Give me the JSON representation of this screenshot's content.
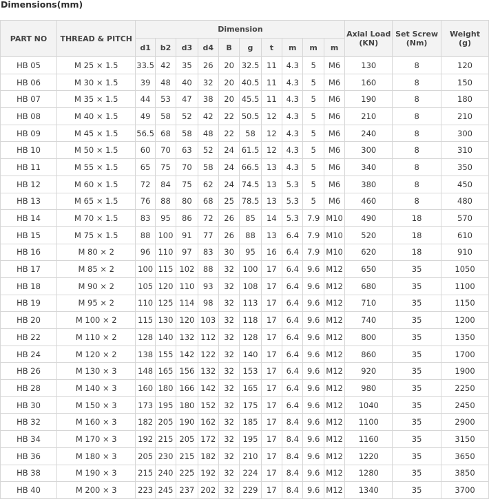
{
  "title": "Dimensions(mm)",
  "header": {
    "part_no": "PART NO",
    "thread_pitch": "THREAD & PITCH",
    "dimension": "Dimension",
    "axial_load": "Axial Load",
    "axial_load_unit": "(KN)",
    "set_screw": "Set Screw",
    "set_screw_unit": "(Nm)",
    "weight": "Weight",
    "weight_unit": "(g)",
    "sub": [
      "d1",
      "b2",
      "d3",
      "d4",
      "B",
      "g",
      "t",
      "m",
      "m",
      "m"
    ]
  },
  "rows": [
    [
      "HB 05",
      "M 25 × 1.5",
      "33.5",
      "42",
      "35",
      "26",
      "20",
      "32.5",
      "11",
      "4.3",
      "5",
      "M6",
      "130",
      "8",
      "120"
    ],
    [
      "HB 06",
      "M 30 × 1.5",
      "39",
      "48",
      "40",
      "32",
      "20",
      "40.5",
      "11",
      "4.3",
      "5",
      "M6",
      "160",
      "8",
      "150"
    ],
    [
      "HB 07",
      "M 35 × 1.5",
      "44",
      "53",
      "47",
      "38",
      "20",
      "45.5",
      "11",
      "4.3",
      "5",
      "M6",
      "190",
      "8",
      "180"
    ],
    [
      "HB 08",
      "M 40 × 1.5",
      "49",
      "58",
      "52",
      "42",
      "22",
      "50.5",
      "12",
      "4.3",
      "5",
      "M6",
      "210",
      "8",
      "210"
    ],
    [
      "HB 09",
      "M 45 × 1.5",
      "56.5",
      "68",
      "58",
      "48",
      "22",
      "58",
      "12",
      "4.3",
      "5",
      "M6",
      "240",
      "8",
      "300"
    ],
    [
      "HB 10",
      "M 50 × 1.5",
      "60",
      "70",
      "63",
      "52",
      "24",
      "61.5",
      "12",
      "4.3",
      "5",
      "M6",
      "300",
      "8",
      "310"
    ],
    [
      "HB 11",
      "M 55 × 1.5",
      "65",
      "75",
      "70",
      "58",
      "24",
      "66.5",
      "13",
      "4.3",
      "5",
      "M6",
      "340",
      "8",
      "350"
    ],
    [
      "HB 12",
      "M 60 × 1.5",
      "72",
      "84",
      "75",
      "62",
      "24",
      "74.5",
      "13",
      "5.3",
      "5",
      "M6",
      "380",
      "8",
      "450"
    ],
    [
      "HB 13",
      "M 65 × 1.5",
      "76",
      "88",
      "80",
      "68",
      "25",
      "78.5",
      "13",
      "5.3",
      "5",
      "M6",
      "460",
      "8",
      "480"
    ],
    [
      "HB 14",
      "M 70 × 1.5",
      "83",
      "95",
      "86",
      "72",
      "26",
      "85",
      "14",
      "5.3",
      "7.9",
      "M10",
      "490",
      "18",
      "570"
    ],
    [
      "HB 15",
      "M 75 × 1.5",
      "88",
      "100",
      "91",
      "77",
      "26",
      "88",
      "13",
      "6.4",
      "7.9",
      "M10",
      "520",
      "18",
      "610"
    ],
    [
      "HB 16",
      "M 80 × 2",
      "96",
      "110",
      "97",
      "83",
      "30",
      "95",
      "16",
      "6.4",
      "7.9",
      "M10",
      "620",
      "18",
      "910"
    ],
    [
      "HB 17",
      "M 85 × 2",
      "100",
      "115",
      "102",
      "88",
      "32",
      "100",
      "17",
      "6.4",
      "9.6",
      "M12",
      "650",
      "35",
      "1050"
    ],
    [
      "HB 18",
      "M 90 × 2",
      "105",
      "120",
      "110",
      "93",
      "32",
      "108",
      "17",
      "6.4",
      "9.6",
      "M12",
      "680",
      "35",
      "1100"
    ],
    [
      "HB 19",
      "M 95 × 2",
      "110",
      "125",
      "114",
      "98",
      "32",
      "113",
      "17",
      "6.4",
      "9.6",
      "M12",
      "710",
      "35",
      "1150"
    ],
    [
      "HB 20",
      "M 100 × 2",
      "115",
      "130",
      "120",
      "103",
      "32",
      "118",
      "17",
      "6.4",
      "9.6",
      "M12",
      "740",
      "35",
      "1200"
    ],
    [
      "HB 22",
      "M 110 × 2",
      "128",
      "140",
      "132",
      "112",
      "32",
      "128",
      "17",
      "6.4",
      "9.6",
      "M12",
      "800",
      "35",
      "1350"
    ],
    [
      "HB 24",
      "M 120 × 2",
      "138",
      "155",
      "142",
      "122",
      "32",
      "140",
      "17",
      "6.4",
      "9.6",
      "M12",
      "860",
      "35",
      "1700"
    ],
    [
      "HB 26",
      "M 130 × 3",
      "148",
      "165",
      "156",
      "132",
      "32",
      "153",
      "17",
      "6.4",
      "9.6",
      "M12",
      "920",
      "35",
      "1900"
    ],
    [
      "HB 28",
      "M 140 × 3",
      "160",
      "180",
      "166",
      "142",
      "32",
      "165",
      "17",
      "6.4",
      "9.6",
      "M12",
      "980",
      "35",
      "2250"
    ],
    [
      "HB 30",
      "M 150 × 3",
      "173",
      "195",
      "180",
      "152",
      "32",
      "175",
      "17",
      "6.4",
      "9.6",
      "M12",
      "1040",
      "35",
      "2450"
    ],
    [
      "HB 32",
      "M 160 × 3",
      "182",
      "205",
      "190",
      "162",
      "32",
      "185",
      "17",
      "8.4",
      "9.6",
      "M12",
      "1100",
      "35",
      "2900"
    ],
    [
      "HB 34",
      "M 170 × 3",
      "192",
      "215",
      "205",
      "172",
      "32",
      "195",
      "17",
      "8.4",
      "9.6",
      "M12",
      "1160",
      "35",
      "3150"
    ],
    [
      "HB 36",
      "M 180 × 3",
      "205",
      "230",
      "215",
      "182",
      "32",
      "210",
      "17",
      "8.4",
      "9.6",
      "M12",
      "1220",
      "35",
      "3650"
    ],
    [
      "HB 38",
      "M 190 × 3",
      "215",
      "240",
      "225",
      "192",
      "32",
      "224",
      "17",
      "8.4",
      "9.6",
      "M12",
      "1280",
      "35",
      "3850"
    ],
    [
      "HB 40",
      "M 200 × 3",
      "223",
      "245",
      "237",
      "202",
      "32",
      "229",
      "17",
      "8.4",
      "9.6",
      "M12",
      "1340",
      "35",
      "3700"
    ]
  ]
}
